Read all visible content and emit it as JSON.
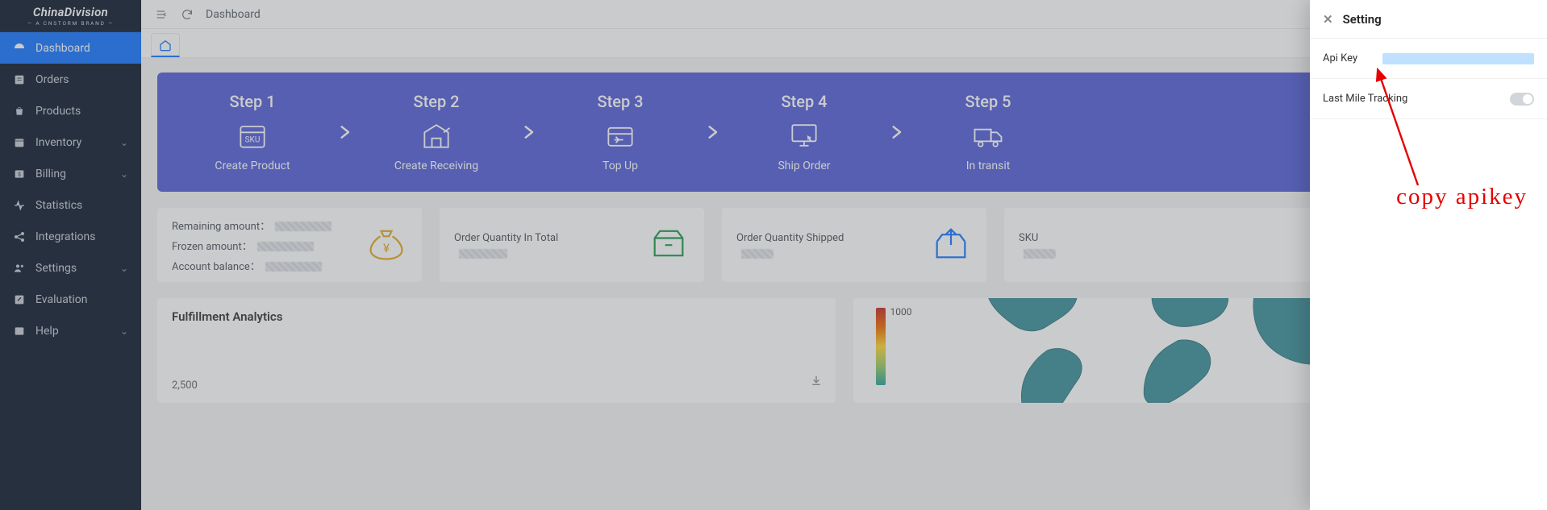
{
  "brand": {
    "name": "ChinaDivision",
    "tagline": "— A CNSTORM BRAND —"
  },
  "sidebar": {
    "items": [
      {
        "label": "Dashboard",
        "expandable": false,
        "active": true
      },
      {
        "label": "Orders",
        "expandable": false
      },
      {
        "label": "Products",
        "expandable": false
      },
      {
        "label": "Inventory",
        "expandable": true
      },
      {
        "label": "Billing",
        "expandable": true
      },
      {
        "label": "Statistics",
        "expandable": false
      },
      {
        "label": "Integrations",
        "expandable": false
      },
      {
        "label": "Settings",
        "expandable": true
      },
      {
        "label": "Evaluation",
        "expandable": false
      },
      {
        "label": "Help",
        "expandable": true
      }
    ]
  },
  "topbar": {
    "title": "Dashboard"
  },
  "steps": [
    {
      "title": "Step 1",
      "caption": "Create Product"
    },
    {
      "title": "Step 2",
      "caption": "Create Receiving"
    },
    {
      "title": "Step 3",
      "caption": "Top Up"
    },
    {
      "title": "Step 4",
      "caption": "Ship Order"
    },
    {
      "title": "Step 5",
      "caption": "In transit"
    }
  ],
  "cards": {
    "balance": {
      "l1": "Remaining amount：",
      "l2": "Frozen amount：",
      "l3": "Account balance："
    },
    "total": {
      "label": "Order Quantity In Total"
    },
    "shipped": {
      "label": "Order Quantity Shipped"
    },
    "sku": {
      "label": "SKU"
    }
  },
  "analytics": {
    "title": "Fulfillment Analytics",
    "y_tick": "2,500",
    "heat_max": "1000"
  },
  "drawer": {
    "title": "Setting",
    "row_api": "Api Key",
    "row_tracking": "Last Mile Tracking"
  },
  "annotation": {
    "text": "copy apikey"
  }
}
